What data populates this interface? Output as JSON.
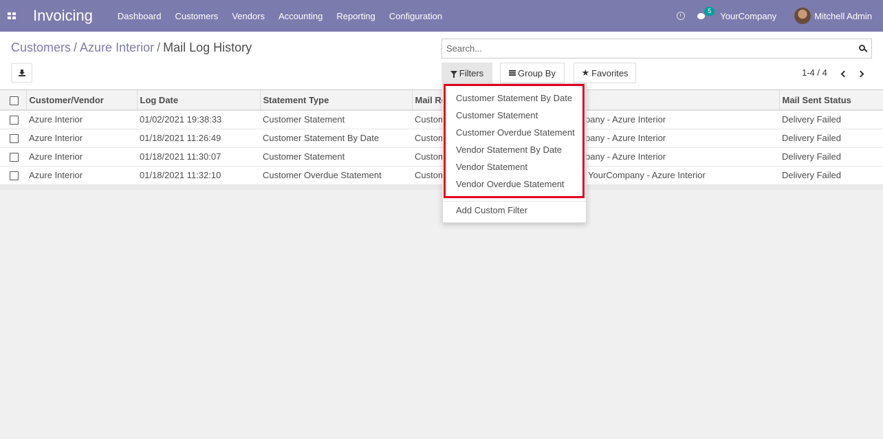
{
  "navbar": {
    "app_title": "Invoicing",
    "menu": [
      "Dashboard",
      "Customers",
      "Vendors",
      "Accounting",
      "Reporting",
      "Configuration"
    ],
    "chat_count": "5",
    "company": "YourCompany",
    "user": "Mitchell Admin",
    "accent_color": "#7c7bad"
  },
  "breadcrumb": {
    "items": [
      "Customers",
      "Azure Interior"
    ],
    "sep": "/",
    "current": "Mail Log History"
  },
  "search": {
    "placeholder": "Search..."
  },
  "buttons": {
    "filters": "Filters",
    "group_by": "Group By",
    "favorites": "Favorites"
  },
  "pager": {
    "value": "1-4 / 4"
  },
  "table": {
    "columns": [
      "Customer/Vendor",
      "Log Date",
      "Statement Type",
      "Mail Re",
      "Mail Sent Status"
    ],
    "rows": [
      {
        "customer": "Azure Interior",
        "date": "01/02/2021 19:38:33",
        "type": "Customer Statement",
        "mail_a": "Custom",
        "mail_b": "pany - Azure Interior",
        "status": "Delivery Failed"
      },
      {
        "customer": "Azure Interior",
        "date": "01/18/2021 11:26:49",
        "type": "Customer Statement By Date",
        "mail_a": "Custom",
        "mail_b": "pany - Azure Interior",
        "status": "Delivery Failed"
      },
      {
        "customer": "Azure Interior",
        "date": "01/18/2021 11:30:07",
        "type": "Customer Statement",
        "mail_a": "Custom",
        "mail_b": "pany - Azure Interior",
        "status": "Delivery Failed"
      },
      {
        "customer": "Azure Interior",
        "date": "01/18/2021 11:32:10",
        "type": "Customer Overdue Statement",
        "mail_a": "Custom",
        "mail_b": "YourCompany - Azure Interior",
        "status": "Delivery Failed"
      }
    ]
  },
  "filters_menu": {
    "items": [
      "Customer Statement By Date",
      "Customer Statement",
      "Customer Overdue Statement",
      "Vendor Statement By Date",
      "Vendor Statement",
      "Vendor Overdue Statement"
    ],
    "custom": "Add Custom Filter",
    "highlight_color": "#e0001b"
  }
}
